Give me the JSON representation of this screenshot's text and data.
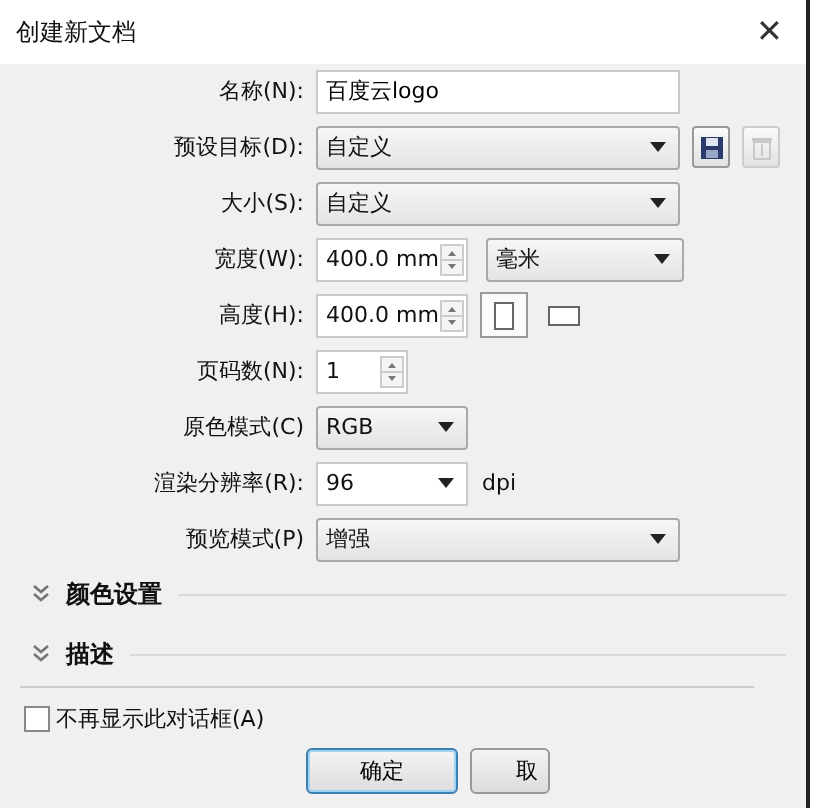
{
  "window": {
    "title": "创建新文档",
    "close": "✕"
  },
  "rows": [
    {
      "kind": "text",
      "label": "名称(N):",
      "value": "百度云logo"
    },
    {
      "kind": "select",
      "label": "预设目标(D):",
      "value": "自定义",
      "save": true,
      "delete_disabled": true
    },
    {
      "kind": "select",
      "label": "大小(S):",
      "value": "自定义"
    },
    {
      "kind": "spin",
      "label": "宽度(W):",
      "value": "400.0 mm",
      "unit": "毫米"
    },
    {
      "kind": "spin",
      "label": "高度(H):",
      "value": "400.0 mm",
      "orientation": [
        {
          "kind": "portrait",
          "selected": true
        },
        {
          "kind": "landscape",
          "selected": false
        }
      ]
    },
    {
      "kind": "smallspin",
      "label": "页码数(N):",
      "value": "1"
    },
    {
      "kind": "shortselect",
      "label": "原色模式(C)",
      "value": "RGB"
    },
    {
      "kind": "combo",
      "label": "渲染分辨率(R):",
      "value": "96",
      "suffix": "dpi"
    },
    {
      "kind": "select",
      "label": "预览模式(P)",
      "value": "增强"
    }
  ],
  "sections": [
    {
      "title": "颜色设置",
      "expanded": false
    },
    {
      "title": "描述",
      "expanded": false
    }
  ],
  "dont_show": {
    "label": "不再显示此对话框(A)",
    "checked": false
  },
  "buttons": [
    "确定",
    "取"
  ]
}
